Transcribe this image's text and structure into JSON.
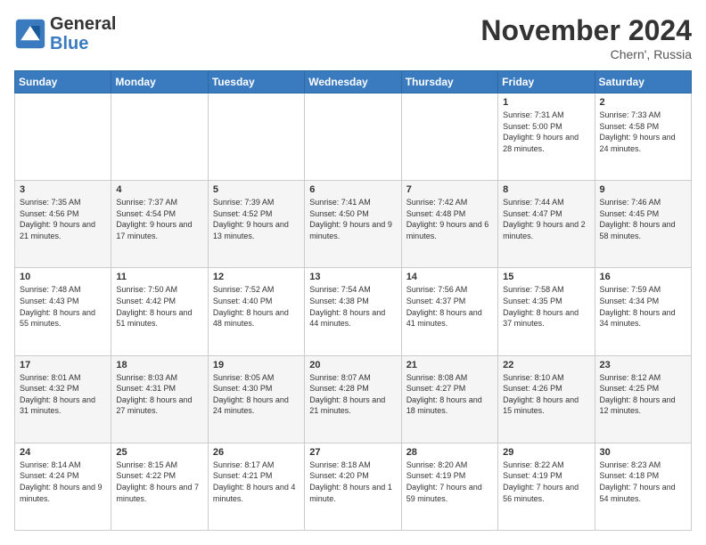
{
  "header": {
    "logo_line1": "General",
    "logo_line2": "Blue",
    "month_title": "November 2024",
    "location": "Chern', Russia"
  },
  "weekdays": [
    "Sunday",
    "Monday",
    "Tuesday",
    "Wednesday",
    "Thursday",
    "Friday",
    "Saturday"
  ],
  "weeks": [
    [
      {
        "day": "",
        "info": ""
      },
      {
        "day": "",
        "info": ""
      },
      {
        "day": "",
        "info": ""
      },
      {
        "day": "",
        "info": ""
      },
      {
        "day": "",
        "info": ""
      },
      {
        "day": "1",
        "info": "Sunrise: 7:31 AM\nSunset: 5:00 PM\nDaylight: 9 hours and 28 minutes."
      },
      {
        "day": "2",
        "info": "Sunrise: 7:33 AM\nSunset: 4:58 PM\nDaylight: 9 hours and 24 minutes."
      }
    ],
    [
      {
        "day": "3",
        "info": "Sunrise: 7:35 AM\nSunset: 4:56 PM\nDaylight: 9 hours and 21 minutes."
      },
      {
        "day": "4",
        "info": "Sunrise: 7:37 AM\nSunset: 4:54 PM\nDaylight: 9 hours and 17 minutes."
      },
      {
        "day": "5",
        "info": "Sunrise: 7:39 AM\nSunset: 4:52 PM\nDaylight: 9 hours and 13 minutes."
      },
      {
        "day": "6",
        "info": "Sunrise: 7:41 AM\nSunset: 4:50 PM\nDaylight: 9 hours and 9 minutes."
      },
      {
        "day": "7",
        "info": "Sunrise: 7:42 AM\nSunset: 4:48 PM\nDaylight: 9 hours and 6 minutes."
      },
      {
        "day": "8",
        "info": "Sunrise: 7:44 AM\nSunset: 4:47 PM\nDaylight: 9 hours and 2 minutes."
      },
      {
        "day": "9",
        "info": "Sunrise: 7:46 AM\nSunset: 4:45 PM\nDaylight: 8 hours and 58 minutes."
      }
    ],
    [
      {
        "day": "10",
        "info": "Sunrise: 7:48 AM\nSunset: 4:43 PM\nDaylight: 8 hours and 55 minutes."
      },
      {
        "day": "11",
        "info": "Sunrise: 7:50 AM\nSunset: 4:42 PM\nDaylight: 8 hours and 51 minutes."
      },
      {
        "day": "12",
        "info": "Sunrise: 7:52 AM\nSunset: 4:40 PM\nDaylight: 8 hours and 48 minutes."
      },
      {
        "day": "13",
        "info": "Sunrise: 7:54 AM\nSunset: 4:38 PM\nDaylight: 8 hours and 44 minutes."
      },
      {
        "day": "14",
        "info": "Sunrise: 7:56 AM\nSunset: 4:37 PM\nDaylight: 8 hours and 41 minutes."
      },
      {
        "day": "15",
        "info": "Sunrise: 7:58 AM\nSunset: 4:35 PM\nDaylight: 8 hours and 37 minutes."
      },
      {
        "day": "16",
        "info": "Sunrise: 7:59 AM\nSunset: 4:34 PM\nDaylight: 8 hours and 34 minutes."
      }
    ],
    [
      {
        "day": "17",
        "info": "Sunrise: 8:01 AM\nSunset: 4:32 PM\nDaylight: 8 hours and 31 minutes."
      },
      {
        "day": "18",
        "info": "Sunrise: 8:03 AM\nSunset: 4:31 PM\nDaylight: 8 hours and 27 minutes."
      },
      {
        "day": "19",
        "info": "Sunrise: 8:05 AM\nSunset: 4:30 PM\nDaylight: 8 hours and 24 minutes."
      },
      {
        "day": "20",
        "info": "Sunrise: 8:07 AM\nSunset: 4:28 PM\nDaylight: 8 hours and 21 minutes."
      },
      {
        "day": "21",
        "info": "Sunrise: 8:08 AM\nSunset: 4:27 PM\nDaylight: 8 hours and 18 minutes."
      },
      {
        "day": "22",
        "info": "Sunrise: 8:10 AM\nSunset: 4:26 PM\nDaylight: 8 hours and 15 minutes."
      },
      {
        "day": "23",
        "info": "Sunrise: 8:12 AM\nSunset: 4:25 PM\nDaylight: 8 hours and 12 minutes."
      }
    ],
    [
      {
        "day": "24",
        "info": "Sunrise: 8:14 AM\nSunset: 4:24 PM\nDaylight: 8 hours and 9 minutes."
      },
      {
        "day": "25",
        "info": "Sunrise: 8:15 AM\nSunset: 4:22 PM\nDaylight: 8 hours and 7 minutes."
      },
      {
        "day": "26",
        "info": "Sunrise: 8:17 AM\nSunset: 4:21 PM\nDaylight: 8 hours and 4 minutes."
      },
      {
        "day": "27",
        "info": "Sunrise: 8:18 AM\nSunset: 4:20 PM\nDaylight: 8 hours and 1 minute."
      },
      {
        "day": "28",
        "info": "Sunrise: 8:20 AM\nSunset: 4:19 PM\nDaylight: 7 hours and 59 minutes."
      },
      {
        "day": "29",
        "info": "Sunrise: 8:22 AM\nSunset: 4:19 PM\nDaylight: 7 hours and 56 minutes."
      },
      {
        "day": "30",
        "info": "Sunrise: 8:23 AM\nSunset: 4:18 PM\nDaylight: 7 hours and 54 minutes."
      }
    ]
  ]
}
